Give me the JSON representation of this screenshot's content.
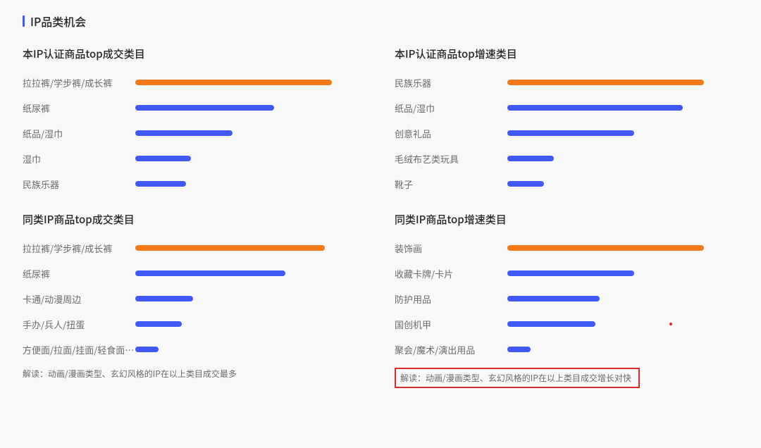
{
  "page_title": "IP品类机会",
  "colors": {
    "highlight": "#f27a1a",
    "normal": "#4058f4",
    "footnote_border": "#d92c2c"
  },
  "panels": [
    {
      "id": "tl",
      "title": "本IP认证商品top成交类目",
      "footnote": "解读：动画/漫画类型、玄幻风格的IP在以上类目成交最多",
      "footnote_highlight": false,
      "rows": [
        {
          "label": "拉拉裤/学步裤/成长裤",
          "pct": 85,
          "color": "orange"
        },
        {
          "label": "纸尿裤",
          "pct": 60,
          "color": "blue"
        },
        {
          "label": "纸品/湿巾",
          "pct": 42,
          "color": "blue"
        },
        {
          "label": "湿巾",
          "pct": 24,
          "color": "blue"
        },
        {
          "label": "民族乐器",
          "pct": 22,
          "color": "blue"
        }
      ]
    },
    {
      "id": "tr",
      "title": "本IP认证商品top增速类目",
      "rows": [
        {
          "label": "民族乐器",
          "pct": 85,
          "color": "orange"
        },
        {
          "label": "纸品/湿巾",
          "pct": 76,
          "color": "blue"
        },
        {
          "label": "创意礼品",
          "pct": 55,
          "color": "blue"
        },
        {
          "label": "毛绒布艺类玩具",
          "pct": 20,
          "color": "blue"
        },
        {
          "label": "靴子",
          "pct": 16,
          "color": "blue"
        }
      ]
    },
    {
      "id": "bl",
      "title": "同类IP商品top成交类目",
      "rows": [
        {
          "label": "拉拉裤/学步裤/成长裤",
          "pct": 82,
          "color": "orange"
        },
        {
          "label": "纸尿裤",
          "pct": 65,
          "color": "blue"
        },
        {
          "label": "卡通/动漫周边",
          "pct": 25,
          "color": "blue"
        },
        {
          "label": "手办/兵人/扭蛋",
          "pct": 20,
          "color": "blue"
        },
        {
          "label": "方便面/拉面/挂面/轻食面速食",
          "pct": 10,
          "color": "blue"
        }
      ]
    },
    {
      "id": "br",
      "title": "同类IP商品top增速类目",
      "footnote": "解读：动画/漫画类型、玄幻风格的IP在以上类目成交增长对快",
      "footnote_highlight": true,
      "rows": [
        {
          "label": "装饰画",
          "pct": 85,
          "color": "orange"
        },
        {
          "label": "收藏卡牌/卡片",
          "pct": 55,
          "color": "blue"
        },
        {
          "label": "防护用品",
          "pct": 40,
          "color": "blue"
        },
        {
          "label": "国创机甲",
          "pct": 38,
          "color": "blue",
          "dot_at": 70
        },
        {
          "label": "聚会/魔术/演出用品",
          "pct": 10,
          "color": "blue"
        }
      ]
    }
  ],
  "chart_data": [
    {
      "type": "bar",
      "title": "本IP认证商品top成交类目",
      "orientation": "horizontal",
      "xlabel": "",
      "ylabel": "",
      "categories": [
        "拉拉裤/学步裤/成长裤",
        "纸尿裤",
        "纸品/湿巾",
        "湿巾",
        "民族乐器"
      ],
      "values": [
        85,
        60,
        42,
        24,
        22
      ],
      "highlight_index": 0
    },
    {
      "type": "bar",
      "title": "本IP认证商品top增速类目",
      "orientation": "horizontal",
      "xlabel": "",
      "ylabel": "",
      "categories": [
        "民族乐器",
        "纸品/湿巾",
        "创意礼品",
        "毛绒布艺类玩具",
        "靴子"
      ],
      "values": [
        85,
        76,
        55,
        20,
        16
      ],
      "highlight_index": 0
    },
    {
      "type": "bar",
      "title": "同类IP商品top成交类目",
      "orientation": "horizontal",
      "xlabel": "",
      "ylabel": "",
      "categories": [
        "拉拉裤/学步裤/成长裤",
        "纸尿裤",
        "卡通/动漫周边",
        "手办/兵人/扭蛋",
        "方便面/拉面/挂面/轻食面速食"
      ],
      "values": [
        82,
        65,
        25,
        20,
        10
      ],
      "highlight_index": 0
    },
    {
      "type": "bar",
      "title": "同类IP商品top增速类目",
      "orientation": "horizontal",
      "xlabel": "",
      "ylabel": "",
      "categories": [
        "装饰画",
        "收藏卡牌/卡片",
        "防护用品",
        "国创机甲",
        "聚会/魔术/演出用品"
      ],
      "values": [
        85,
        55,
        40,
        38,
        10
      ],
      "highlight_index": 0
    }
  ]
}
